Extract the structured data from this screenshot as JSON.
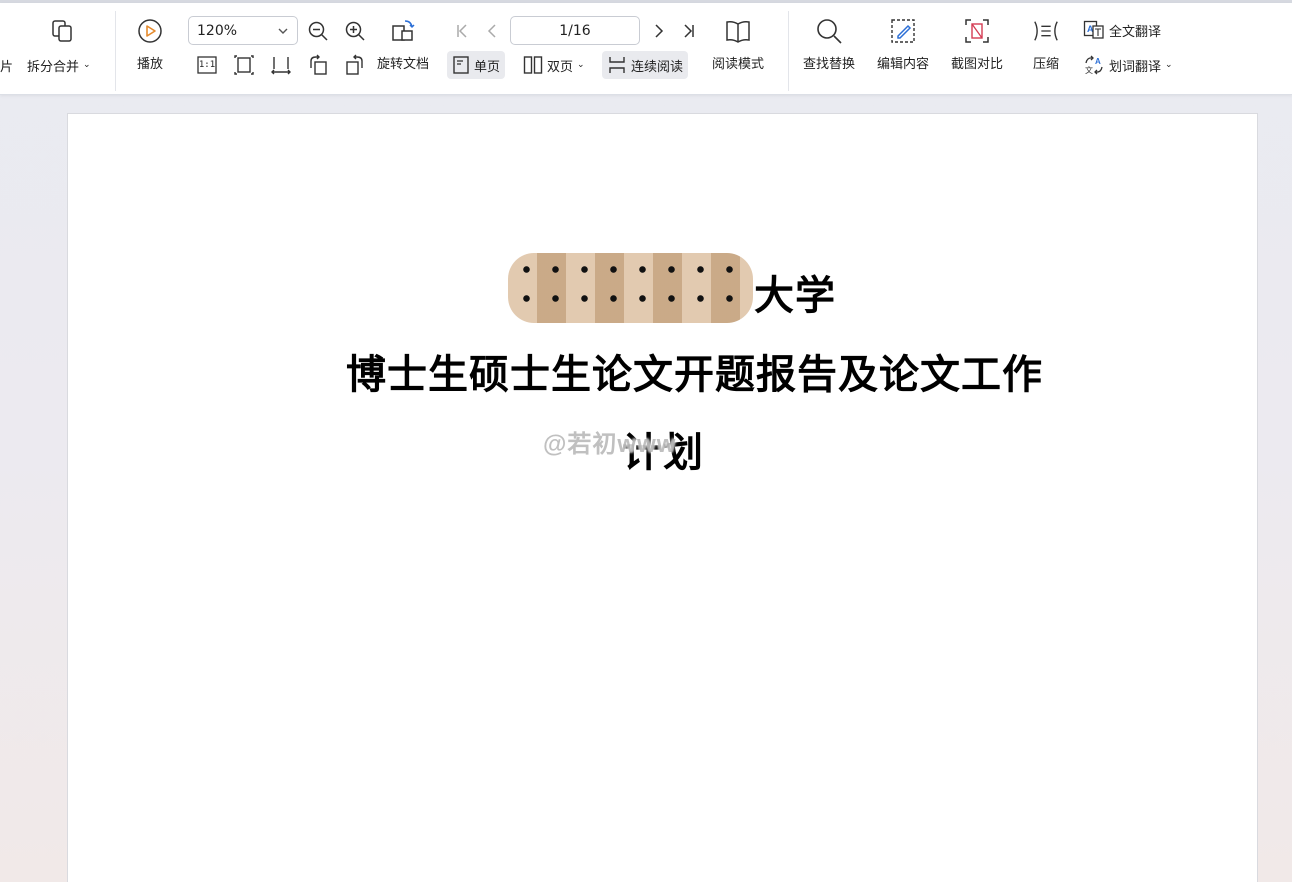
{
  "toolbar": {
    "cut_left_label": "片",
    "split_merge": "拆分合并",
    "play": "播放",
    "zoom_value": "120%",
    "page_indicator": "1/16",
    "rotate_doc": "旋转文档",
    "single_page": "单页",
    "double_page": "双页",
    "continuous_read": "连续阅读",
    "read_mode": "阅读模式",
    "find_replace": "查找替换",
    "edit_content": "编辑内容",
    "screenshot_compare": "截图对比",
    "compress": "压缩",
    "full_translate": "全文翻译",
    "word_translate": "划词翻译",
    "actual_size_glyph": "1:1"
  },
  "document": {
    "university_suffix": "大学",
    "title_line1": "博士生硕士生论文开题报告及论文工作",
    "title_line2": "计划",
    "watermark": "@若初www"
  },
  "colors": {
    "accent_play": "#e58a2c",
    "accent_blue": "#2c6fd6",
    "accent_red": "#d43b53",
    "active_bg": "#e9eaee"
  }
}
